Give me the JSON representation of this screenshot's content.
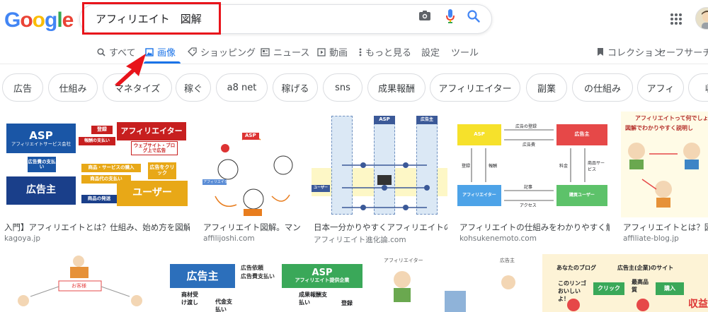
{
  "header": {
    "logo": [
      "G",
      "o",
      "o",
      "g",
      "l",
      "e"
    ],
    "logo_colors": [
      "#4285f4",
      "#ea4335",
      "#fbbc05",
      "#4285f4",
      "#34a853",
      "#ea4335"
    ],
    "search_value": "アフィリエイト　図解"
  },
  "tabs": {
    "all": "すべて",
    "images": "画像",
    "shopping": "ショッピング",
    "news": "ニュース",
    "videos": "動画",
    "more": "もっと見る",
    "settings": "設定",
    "tools": "ツール",
    "collections": "コレクション",
    "safesearch": "セーフサーチ"
  },
  "chips": [
    "広告",
    "仕組み",
    "マネタイズ",
    "稼ぐ",
    "a8 net",
    "稼げる",
    "sns",
    "成果報酬",
    "アフィリエイター",
    "副業",
    "の仕組み",
    "アフィ",
    "収"
  ],
  "results": [
    {
      "title": "入門】アフィリエイトとは？仕組み、始め方を図解で…",
      "source": "kagoya.jp"
    },
    {
      "title": "アフィリエイト図解。マン…",
      "source": "affilijoshi.com"
    },
    {
      "title": "日本一分かりやすくアフィリエイトの…",
      "source": "アフィリエイト進化論.com"
    },
    {
      "title": "アフィリエイトの仕組みをわかりやすく解…",
      "source": "kohsukenemoto.com"
    },
    {
      "title": "アフィリエイトとは？図解",
      "source": "affiliate-blog.jp"
    }
  ],
  "thumb1": {
    "asp": "ASP",
    "asp_sub": "アフィリエイトサービス会社",
    "register": "登録",
    "reward_pay": "報酬の支払い",
    "affiliator": "アフィリエイター",
    "website": "ウェブサイト・ブログ上で広告",
    "ad_fee": "広告費の支払い",
    "purchase": "商品・サービスの購入",
    "click": "広告をクリック",
    "product_pay": "商品代の支払い",
    "advertiser": "広告主",
    "user": "ユーザー",
    "ship": "商品の発送"
  },
  "thumb2": {
    "asp": "ASP",
    "affiliator": "アフィリエイター"
  },
  "thumb3": {
    "asp": "ASP",
    "advertiser": "広告主",
    "user": "ユーザー"
  },
  "thumb4": {
    "ad_register": "広告の登録",
    "ad_fee": "広告費",
    "asp": "ASP",
    "advertiser": "広告主",
    "register": "登録",
    "reward": "報酬",
    "fee": "料金",
    "product": "商品サービス",
    "article": "記事",
    "access": "アクセス",
    "affiliator": "アフィリエイター",
    "buyer": "購買ユーザー"
  },
  "thumb5": {
    "title": "アフィリエイトって何でしょ",
    "sub": "図解でわかりやすく説明し"
  },
  "row2": {
    "t1_label": "お客様",
    "t2_advertiser": "広告主",
    "t2_request": "広告依頼",
    "t2_pay": "広告費支払い",
    "t2_asp": "ASP",
    "t2_asp_sub": "アフィリエイト提供企業",
    "t2_goods": "商材受け渡し",
    "t2_price": "代金支払い",
    "t2_reward": "成果報酬支払い",
    "t2_register": "登録",
    "t3_affiliator": "アフィリエイター",
    "t3_advertiser": "広告主",
    "t4_blog": "あなたのブログ",
    "t4_company": "広告主(企業)のサイト",
    "t4_apple": "このリンゴおいしいよ！",
    "t4_click": "クリック",
    "t4_best": "最高品質",
    "t4_buy": "購入",
    "t4_income": "収益"
  }
}
